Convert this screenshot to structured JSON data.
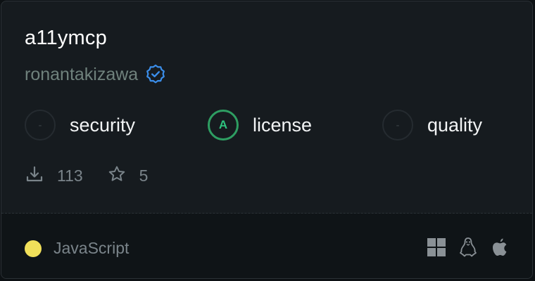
{
  "package": {
    "name": "a11ymcp",
    "author": "ronantakizawa",
    "verified_icon": "verified-badge-icon"
  },
  "scores": [
    {
      "label": "security",
      "grade": "-"
    },
    {
      "label": "license",
      "grade": "A"
    },
    {
      "label": "quality",
      "grade": "-"
    }
  ],
  "stats": {
    "downloads": "113",
    "stars": "5",
    "download_icon": "download-icon",
    "star_icon": "star-icon"
  },
  "footer": {
    "language": "JavaScript",
    "language_color": "#f1e05a",
    "platforms": [
      "windows-icon",
      "linux-icon",
      "apple-icon"
    ]
  },
  "colors": {
    "grade_a": "#2e9e62",
    "verified": "#3b8eea"
  }
}
